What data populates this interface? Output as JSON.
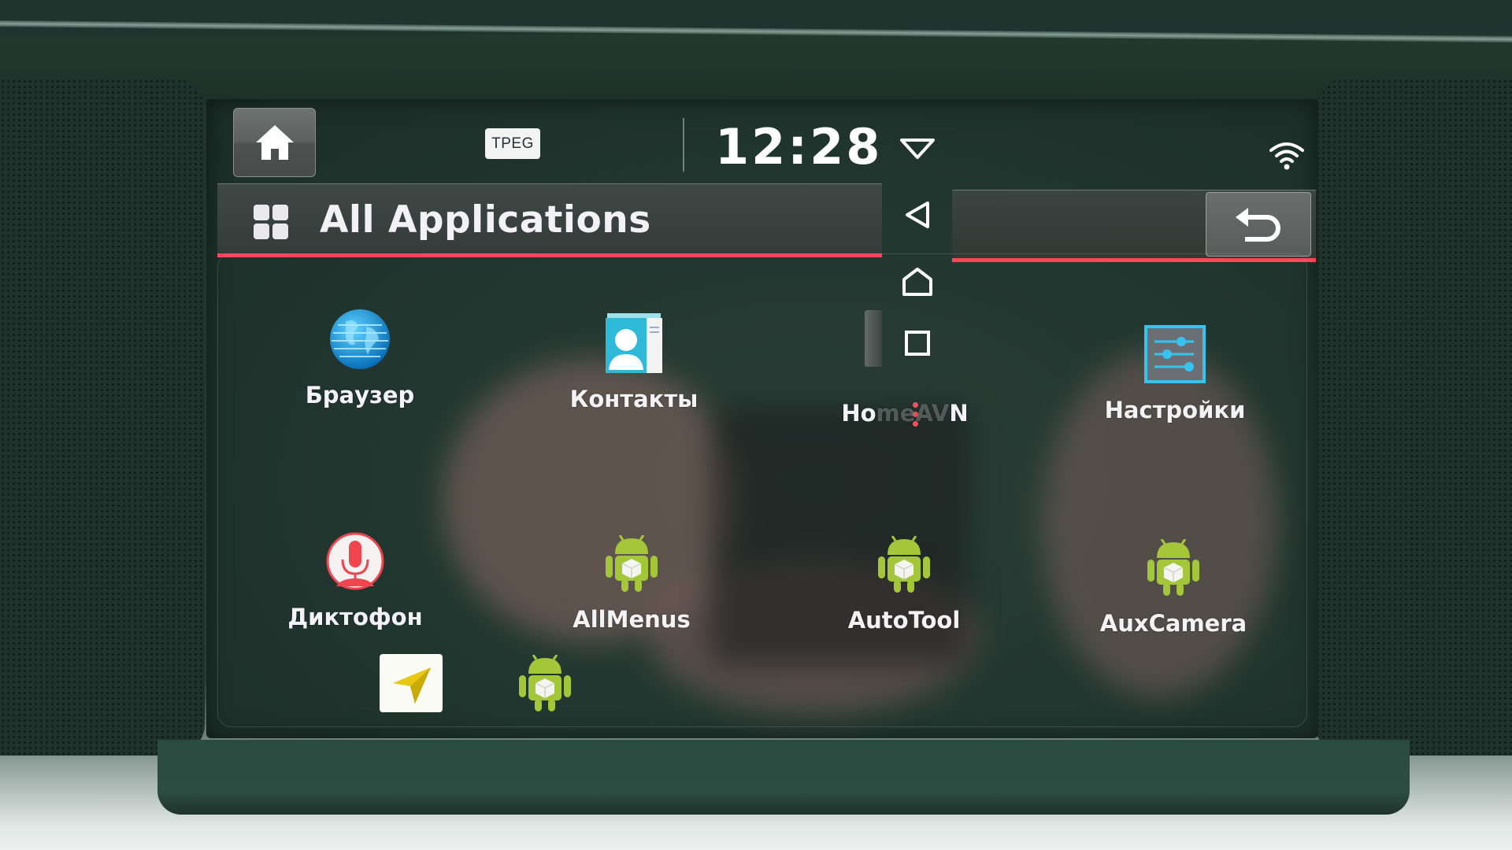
{
  "status_bar": {
    "home_button_label": "Home",
    "tpeg_badge": "TPEG",
    "clock": "12:28",
    "wifi_icon": "wifi-icon",
    "dropdown_icon": "chevron-down-triangle-icon"
  },
  "header": {
    "icon": "apps-grid-icon",
    "title": "All Applications",
    "back_icon": "back-return-icon"
  },
  "android_nav": {
    "items": [
      {
        "name": "back",
        "icon": "triangle-left-icon"
      },
      {
        "name": "home",
        "icon": "home-outline-icon"
      },
      {
        "name": "recents",
        "icon": "square-icon"
      }
    ],
    "overflow_icon": "more-vertical-dots-icon"
  },
  "apps": [
    {
      "label": "Браузер",
      "icon": "globe-icon"
    },
    {
      "label": "Контакты",
      "icon": "contacts-icon"
    },
    {
      "label_visible": "Ho",
      "label_dim": "meAV",
      "label_tail": "N",
      "label": "HomeAVN",
      "icon": "none"
    },
    {
      "label": "Настройки",
      "icon": "settings-sliders-icon"
    },
    {
      "label": "Диктофон",
      "icon": "microphone-icon"
    },
    {
      "label": "AllMenus",
      "icon": "android-icon"
    },
    {
      "label": "AutoTool",
      "icon": "android-icon"
    },
    {
      "label": "AuxCamera",
      "icon": "android-icon"
    },
    {
      "label": "",
      "icon": "navigation-arrow-icon"
    },
    {
      "label": "",
      "icon": "android-icon"
    }
  ],
  "colors": {
    "accent_red": "#ff4559",
    "android_green": "#a4c639",
    "globe_blue": "#1aa3e0",
    "contacts_cyan": "#2fb9d8",
    "mic_red": "#f0444f"
  }
}
